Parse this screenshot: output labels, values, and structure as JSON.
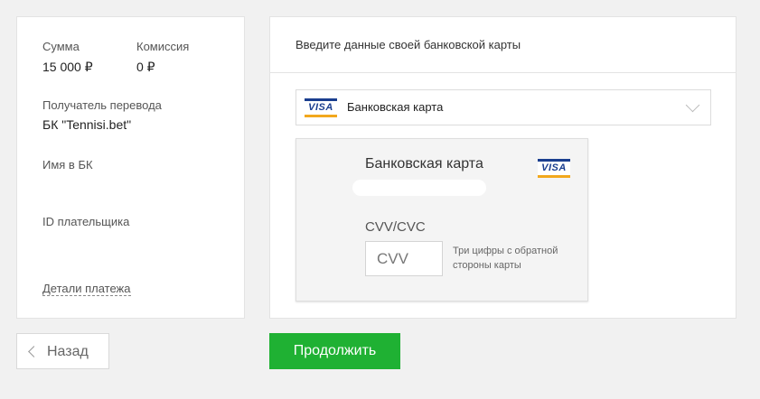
{
  "summary": {
    "amount_label": "Сумма",
    "amount_value": "15 000 ₽",
    "fee_label": "Комиссия",
    "fee_value": "0 ₽",
    "recipient_label": "Получатель перевода",
    "recipient_value": "БК \"Tennisi.bet\"",
    "bk_name_label": "Имя в БК",
    "payer_id_label": "ID плательщика",
    "details_link": "Детали платежа"
  },
  "payment": {
    "header": "Введите данные своей банковской карты",
    "selected_card": "Банковская карта",
    "card_brand_icon": "visa-logo",
    "card_brand_text": "VISA",
    "card_title": "Банковская карта",
    "cvv_label": "CVV/CVC",
    "cvv_placeholder": "CVV",
    "cvv_hint": "Три цифры с обратной стороны карты"
  },
  "actions": {
    "back_label": "Назад",
    "back_icon": "chevron-left-icon",
    "continue_label": "Продолжить"
  },
  "colors": {
    "accent": "#1fb133",
    "visa_blue": "#1a3e8f",
    "visa_gold": "#f2a81d"
  }
}
